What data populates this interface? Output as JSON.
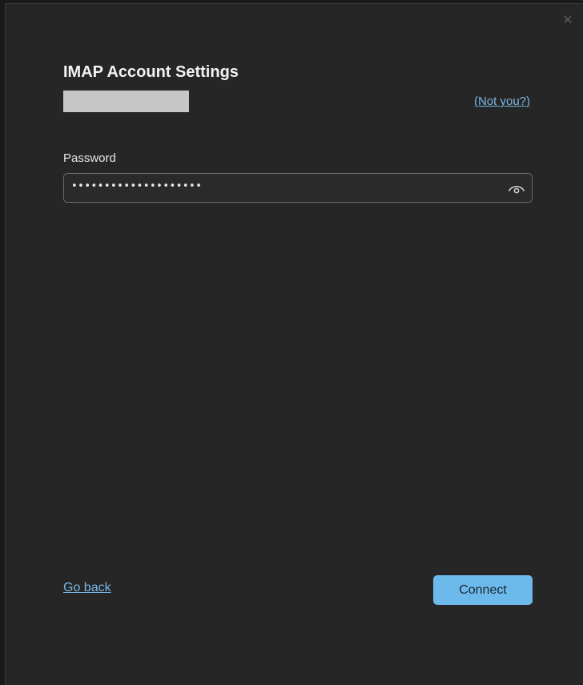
{
  "dialog": {
    "close_glyph": "✕",
    "title": "IMAP Account Settings",
    "not_you_link": "(Not you?)",
    "password_label": "Password",
    "password_value": "••••••••••••••••••••",
    "go_back_link": "Go back",
    "connect_button": "Connect"
  },
  "icons": {
    "close": "close-icon",
    "reveal_password": "eye-icon"
  },
  "colors": {
    "background": "#262626",
    "accent": "#6cb9ec",
    "link": "#7ab8e6",
    "redaction": "#c6c6c6"
  }
}
